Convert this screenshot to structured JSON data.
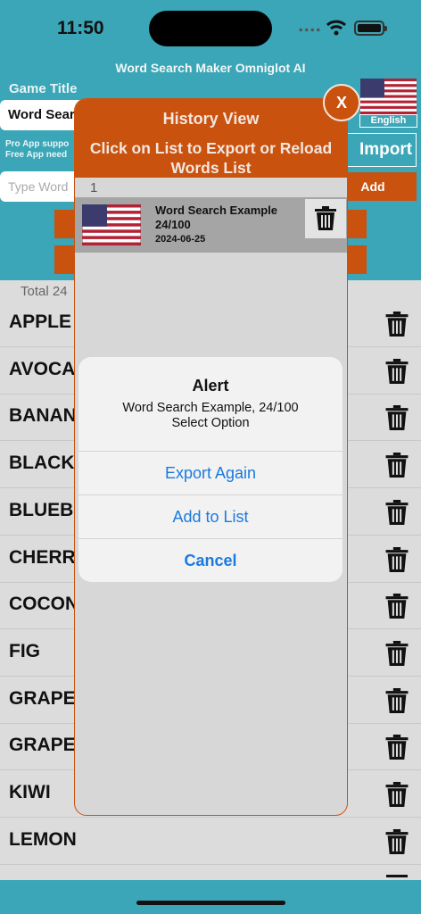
{
  "status_bar": {
    "time": "11:50"
  },
  "app": {
    "title": "Word Search Maker Omniglot AI"
  },
  "header": {
    "game_title_label": "Game Title",
    "game_title_value": "Word Sear",
    "language_label": "English",
    "pro_note_line1": "Pro App suppo",
    "pro_note_line2": "Free App need",
    "import_label": "Import",
    "word_input_placeholder": "Type Word",
    "add_label": "Add"
  },
  "word_list": {
    "total_label": "Total 24",
    "items": [
      "APPLE",
      "AVOCA",
      "BANAN",
      "BLACK",
      "BLUEBI",
      "CHERR",
      "COCON",
      "FIG",
      "GRAPE",
      "GRAPE",
      "KIWI",
      "LEMON"
    ]
  },
  "history_modal": {
    "title": "History View",
    "subtitle_line1": "Click on List to Export or Reload",
    "subtitle_line2": "Words List",
    "close_label": "X",
    "count": "1",
    "entries": [
      {
        "name_line1": "Word Search Example",
        "name_line2": "24/100",
        "date": "2024-06-25",
        "flag_icon": "us-flag-icon"
      }
    ]
  },
  "alert": {
    "title": "Alert",
    "message_line1": "Word Search Example, 24/100",
    "message_line2": "Select Option",
    "buttons": [
      "Export Again",
      "Add to List",
      "Cancel"
    ]
  },
  "colors": {
    "teal": "#3aa6b7",
    "orange": "#c9520f",
    "ios_blue": "#1a7ae0"
  }
}
